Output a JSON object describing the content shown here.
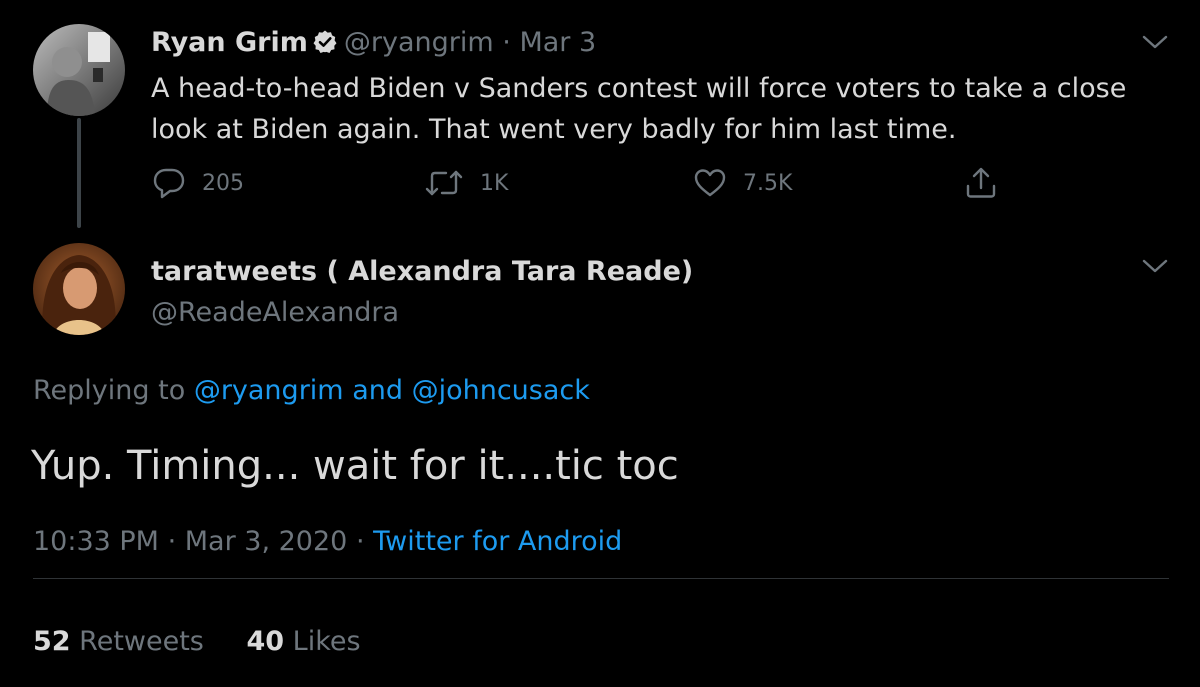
{
  "tweet1": {
    "author_name": "Ryan Grim",
    "handle": "@ryangrim",
    "separator": "·",
    "date": "Mar 3",
    "text": "A head-to-head Biden v Sanders contest will force voters to take a close look at Biden again. That went very badly for him last time.",
    "reply_count": "205",
    "retweet_count": "1K",
    "like_count": "7.5K"
  },
  "tweet2": {
    "author_name": "taratweets ( Alexandra Tara Reade)",
    "handle": "@ReadeAlexandra",
    "replying_prefix": "Replying to",
    "reply_to_1": "@ryangrim",
    "reply_and": "and",
    "reply_to_2": "@johncusack",
    "text": "Yup. Timing... wait for it....tic toc",
    "time": "10:33 PM",
    "separator": "·",
    "date": "Mar 3, 2020",
    "separator2": "·",
    "source": "Twitter for Android",
    "retweets_count": "52",
    "retweets_label": "Retweets",
    "likes_count": "40",
    "likes_label": "Likes"
  },
  "icons": {
    "verified": "verified-badge-icon",
    "chevron": "chevron-down-icon",
    "reply": "reply-bubble-icon",
    "retweet": "retweet-icon",
    "like": "heart-icon",
    "share": "share-icon"
  },
  "colors": {
    "background": "#000000",
    "text": "#d9d9d9",
    "secondary": "#6e767d",
    "link": "#1d9bf0",
    "divider": "#2f3336"
  }
}
